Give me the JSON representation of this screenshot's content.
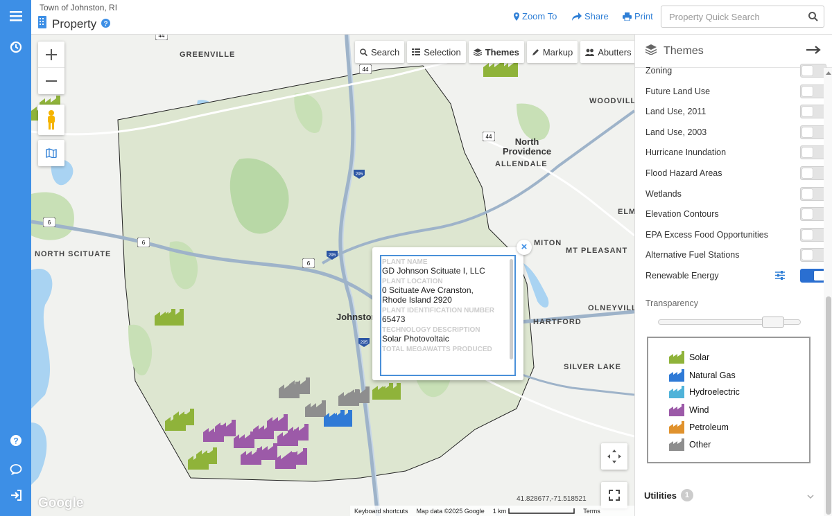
{
  "header": {
    "town": "Town of Johnston, RI",
    "module": "Property",
    "zoom_to": "Zoom To",
    "share": "Share",
    "print": "Print",
    "search_placeholder": "Property Quick Search"
  },
  "map": {
    "toolbar": {
      "search": "Search",
      "selection": "Selection",
      "themes": "Themes",
      "markup": "Markup",
      "abutters": "Abutters"
    },
    "places": {
      "greenville": "GREENVILLE",
      "woodville": "WOODVILLE",
      "north_providence_1": "North",
      "north_providence_2": "Providence",
      "allendale": "ALLENDALE",
      "north_scituate": "NORTH SCITUATE",
      "elm": "ELM",
      "mount": "MITON",
      "mt_pleasant": "MT PLEASANT",
      "olneyville": "OLNEYVILLE",
      "hartford": "HARTFORD",
      "silver_lake": "SILVER LAKE",
      "johnston": "Johnston"
    },
    "shields": [
      "44",
      "44",
      "44",
      "6",
      "6",
      "6",
      "295",
      "295",
      "295"
    ],
    "popup": {
      "plant_name_label": "PLANT NAME",
      "plant_name": "GD Johnson Scituate I, LLC",
      "location_label": "PLANT LOCATION",
      "location_1": "0 Scituate Ave Cranston,",
      "location_2": "Rhode Island 2920",
      "id_label": "PLANT IDENTIFICATION NUMBER",
      "id": "65473",
      "tech_label": "TECHNOLOGY DESCRIPTION",
      "tech": "Solar Photovoltaic",
      "mw_label": "TOTAL MEGAWATTS PRODUCED"
    },
    "google": "Google",
    "coords": "41.828677,-71.518521",
    "attribution": {
      "shortcuts": "Keyboard shortcuts",
      "mapdata": "Map data ©2025 Google",
      "scale": "1 km",
      "terms": "Terms"
    }
  },
  "panel": {
    "title": "Themes",
    "layers": [
      {
        "label": "Zoning",
        "on": false
      },
      {
        "label": "Future Land Use",
        "on": false
      },
      {
        "label": "Land Use, 2011",
        "on": false
      },
      {
        "label": "Land Use, 2003",
        "on": false
      },
      {
        "label": "Hurricane Inundation",
        "on": false
      },
      {
        "label": "Flood Hazard Areas",
        "on": false
      },
      {
        "label": "Wetlands",
        "on": false
      },
      {
        "label": "Elevation Contours",
        "on": false
      },
      {
        "label": "EPA Excess Food Opportunities",
        "on": false
      },
      {
        "label": "Alternative Fuel Stations",
        "on": false
      },
      {
        "label": "Renewable Energy",
        "on": true
      }
    ],
    "transparency_label": "Transparency",
    "transparency_value": 0.8,
    "legend": [
      {
        "label": "Solar",
        "color": "#8fb33a"
      },
      {
        "label": "Natural Gas",
        "color": "#2f7ad6"
      },
      {
        "label": "Hydroelectric",
        "color": "#4fb3d9"
      },
      {
        "label": "Wind",
        "color": "#9c5aa8"
      },
      {
        "label": "Petroleum",
        "color": "#e0922d"
      },
      {
        "label": "Other",
        "color": "#8e8e8e"
      }
    ],
    "utilities_label": "Utilities",
    "utilities_count": "1"
  }
}
